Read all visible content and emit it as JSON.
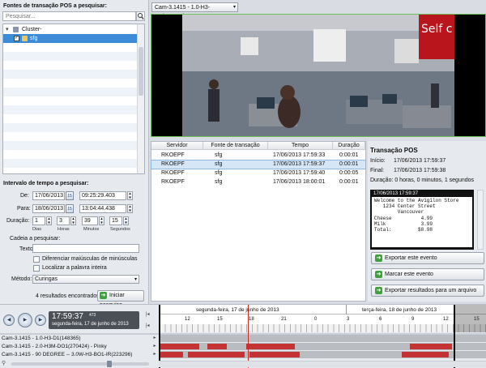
{
  "left": {
    "sources_title": "Fontes de transação POS a pesquisar:",
    "search_placeholder": "Pesquisar...",
    "tree": [
      {
        "label": "Cluster-",
        "indent": 1
      },
      {
        "label": "sfg",
        "indent": 2,
        "checked": true,
        "selected": true
      }
    ],
    "interval_title": "Intervalo de tempo a pesquisar:",
    "from_label": "De:",
    "from_date": "17/06/2013",
    "from_time": "09:25:29.403",
    "to_label": "Para:",
    "to_date": "18/06/2013",
    "to_time": "13:04:44.438",
    "duration_label": "Duração:",
    "duration": {
      "days": "1",
      "hours": "3",
      "minutes": "39",
      "seconds": "15"
    },
    "duration_units": {
      "days": "Dias",
      "hours": "Horas",
      "minutes": "Minutos",
      "seconds": "Segundos"
    },
    "chain_title": "Cadeia a pesquisar:",
    "text_label": "Texto:",
    "text_value": "",
    "case_label": "Diferenciar maiúsculas de minúsculas",
    "whole_word_label": "Localizar a palavra inteira",
    "method_label": "Método:",
    "method_value": "Curingas",
    "results_found": "4 resultados encontrados",
    "start_search": "Iniciar pesquisa"
  },
  "camera_select": "Cam-3.1415 - 1.0-H3-D1(148365)",
  "results": {
    "headers": [
      "Servidor",
      "Fonte de transação",
      "Tempo",
      "Duração"
    ],
    "rows": [
      [
        "RKOEPF",
        "sfg",
        "17/06/2013 17:59:33",
        "0:00:01"
      ],
      [
        "RKOEPF",
        "sfg",
        "17/06/2013 17:59:37",
        "0:00:01"
      ],
      [
        "RKOEPF",
        "sfg",
        "17/06/2013 17:59:40",
        "0:00:05"
      ],
      [
        "RKOEPF",
        "sfg",
        "17/06/2013 18:00:01",
        "0:00:01"
      ]
    ],
    "selected_row": 1
  },
  "transaction": {
    "title": "Transação POS",
    "start_label": "Início:",
    "start_value": "17/06/2013 17:59:37",
    "end_label": "Final:",
    "end_value": "17/06/2013 17:59:38",
    "duration_text": "Duração: 0 horas, 0 minutos, 1 segundos",
    "receipt_header": "17/06/2013 17:59:37",
    "receipt_lines": [
      "Welcome to the Avigilon Store",
      "   1234 Center Street",
      "        Vancouver",
      "Cheese          4.99",
      "Milk            3.99",
      "Total:         $8.98"
    ],
    "actions": [
      "Exportar este evento",
      "Marcar este evento",
      "Exportar resultados para um arquivo"
    ]
  },
  "timeline": {
    "current_time": "17:59:37",
    "current_ms": "473",
    "current_date": "segunda-feira, 17 de junho de 2013",
    "day1": "segunda-feira, 17 de junho de 2013",
    "day2": "terça-feira, 18 de junho de 2013",
    "hour_ticks": [
      "12",
      "15",
      "18",
      "21",
      "0",
      "3",
      "6",
      "9",
      "12",
      "15"
    ],
    "tracks": [
      "Cam-3.1415 - 1.0-H3-D1(148365)",
      "Cam-3.1415 - 2.0-H3M-DO1(270424) - Pinky",
      "Cam-3.1415 - 90 DEGREE -- 3.0W-H3-BO1-IR(223296)"
    ]
  },
  "colors": {
    "accent": "#3d8ad6",
    "recording": "#c43333",
    "video_border": "#6fbf5a"
  }
}
